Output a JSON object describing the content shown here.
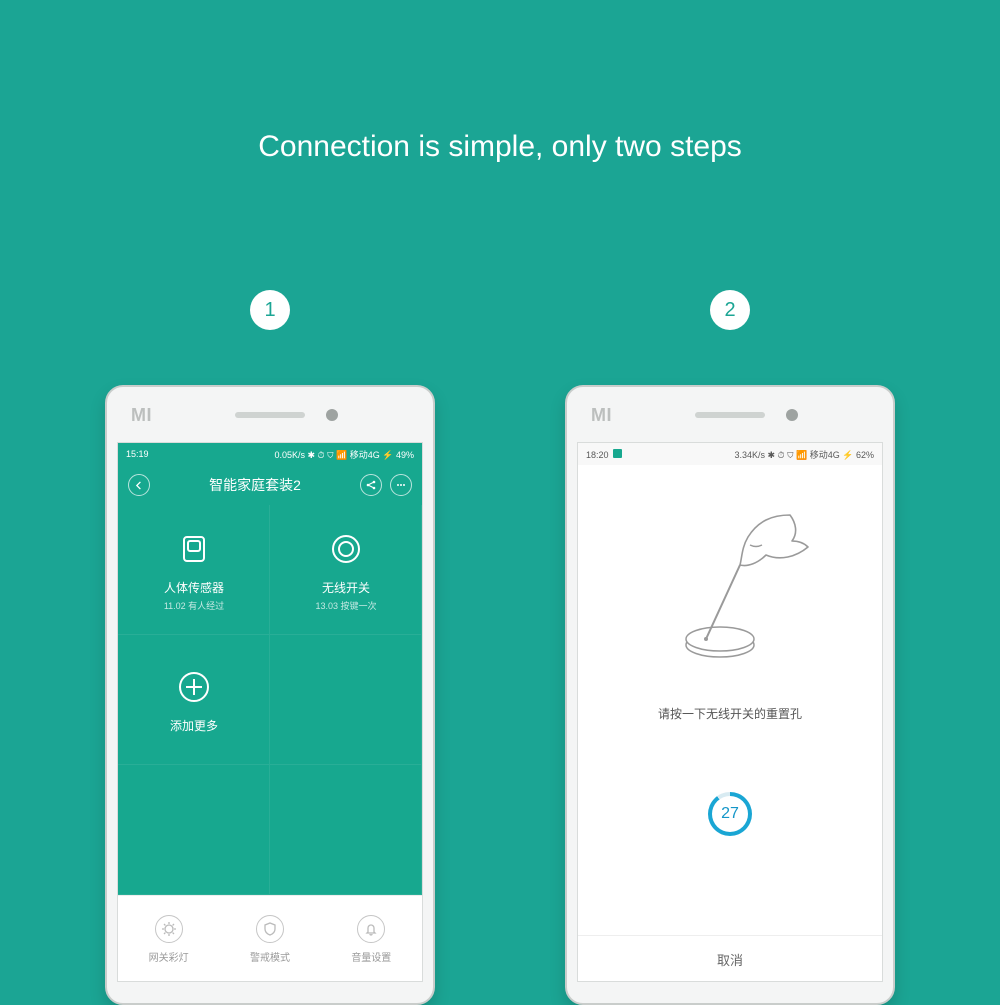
{
  "headline": "Connection is simple, only two steps",
  "steps": {
    "one": "1",
    "two": "2"
  },
  "brand": "MI",
  "phone1": {
    "status": {
      "time": "15:19",
      "right": "0.05K/s  ✱ ⏱ ⛉ 📶 移动4G ⚡ 49%"
    },
    "header": {
      "title": "智能家庭套装2"
    },
    "tiles": {
      "t1": {
        "title": "人体传感器",
        "sub": "11.02 有人经过"
      },
      "t2": {
        "title": "无线开关",
        "sub": "13.03 按键一次"
      },
      "t3": {
        "title": "添加更多"
      }
    },
    "bottom": {
      "b1": "网关彩灯",
      "b2": "警戒模式",
      "b3": "音量设置"
    }
  },
  "phone2": {
    "status": {
      "time": "18:20",
      "right": "3.34K/s ✱ ⏱ ⛉ 📶 移动4G ⚡ 62%"
    },
    "instruction": "请按一下无线开关的重置孔",
    "countdown": "27",
    "cancel": "取消"
  }
}
